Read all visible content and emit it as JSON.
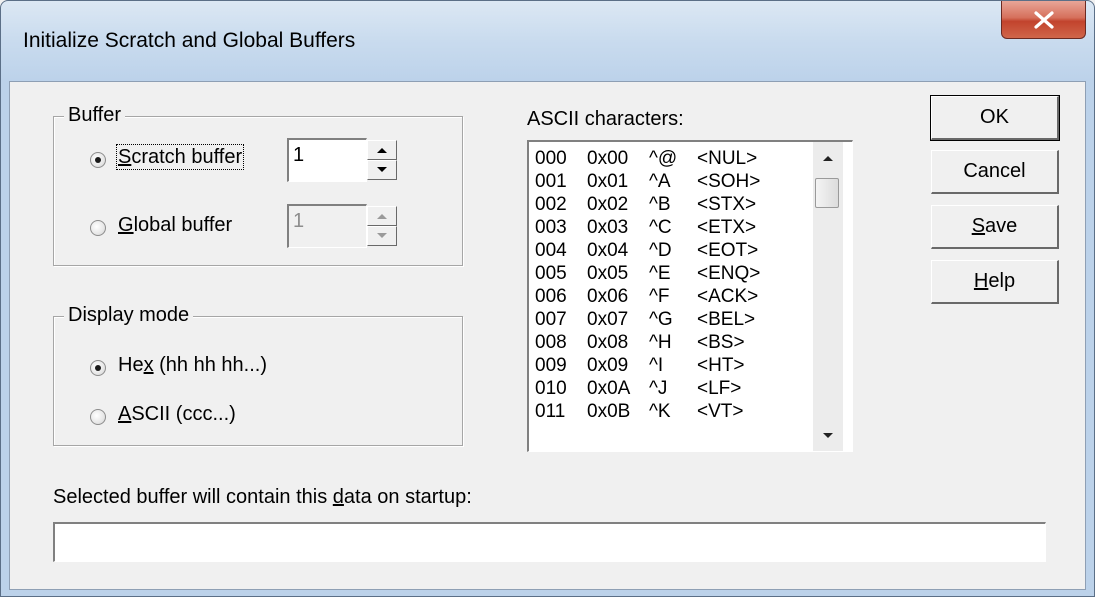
{
  "window": {
    "title": "Initialize Scratch and Global Buffers",
    "close_icon": "close-x-icon"
  },
  "buffer_group": {
    "caption": "Buffer",
    "scratch": {
      "label_pre": "",
      "label_access": "S",
      "label_post": "cratch buffer",
      "selected": true,
      "value": "1"
    },
    "global": {
      "label_pre": "",
      "label_access": "G",
      "label_post": "lobal buffer",
      "selected": false,
      "value": "1"
    }
  },
  "display_group": {
    "caption": "Display mode",
    "hex": {
      "label_pre": "He",
      "label_access": "x",
      "label_post": " (hh hh hh...)",
      "selected": true
    },
    "ascii": {
      "label_pre": "",
      "label_access": "A",
      "label_post": "SCII (ccc...)",
      "selected": false
    }
  },
  "ascii_list": {
    "label": "ASCII characters:",
    "rows": [
      {
        "dec": "000",
        "hex": "0x00",
        "ctrl": "^@",
        "name": "<NUL>"
      },
      {
        "dec": "001",
        "hex": "0x01",
        "ctrl": "^A",
        "name": "<SOH>"
      },
      {
        "dec": "002",
        "hex": "0x02",
        "ctrl": "^B",
        "name": "<STX>"
      },
      {
        "dec": "003",
        "hex": "0x03",
        "ctrl": "^C",
        "name": "<ETX>"
      },
      {
        "dec": "004",
        "hex": "0x04",
        "ctrl": "^D",
        "name": "<EOT>"
      },
      {
        "dec": "005",
        "hex": "0x05",
        "ctrl": "^E",
        "name": "<ENQ>"
      },
      {
        "dec": "006",
        "hex": "0x06",
        "ctrl": "^F",
        "name": "<ACK>"
      },
      {
        "dec": "007",
        "hex": "0x07",
        "ctrl": "^G",
        "name": "<BEL>"
      },
      {
        "dec": "008",
        "hex": "0x08",
        "ctrl": "^H",
        "name": "<BS>"
      },
      {
        "dec": "009",
        "hex": "0x09",
        "ctrl": "^I",
        "name": "<HT>"
      },
      {
        "dec": "010",
        "hex": "0x0A",
        "ctrl": "^J",
        "name": "<LF>"
      },
      {
        "dec": "011",
        "hex": "0x0B",
        "ctrl": "^K",
        "name": "<VT>"
      }
    ]
  },
  "buttons": {
    "ok": {
      "pre": "OK",
      "access": "",
      "post": ""
    },
    "cancel": {
      "pre": "Cancel",
      "access": "",
      "post": ""
    },
    "save": {
      "pre": "",
      "access": "S",
      "post": "ave"
    },
    "help": {
      "pre": "",
      "access": "H",
      "post": "elp"
    }
  },
  "startup": {
    "label_pre": "Selected buffer will contain this ",
    "label_access": "d",
    "label_post": "ata on startup:",
    "value": ""
  }
}
